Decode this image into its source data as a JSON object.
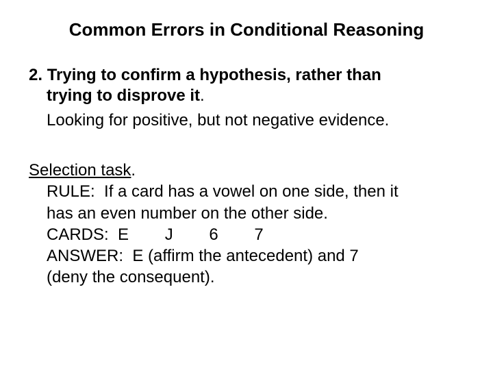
{
  "title": "Common Errors in Conditional Reasoning",
  "error": {
    "number": "2.",
    "heading_line1": "Trying to confirm a hypothesis, rather than",
    "heading_line2": "trying to disprove it",
    "heading_tail": ".",
    "explanation": "Looking for positive, but not negative evidence."
  },
  "task": {
    "label": "Selection task",
    "label_tail": ".",
    "rule_label": "RULE:",
    "rule_text_1": "If a card has a vowel on one side, then it",
    "rule_text_2": "has an even number on the other side.",
    "cards_label": "CARDS:",
    "cards": [
      "E",
      "J",
      "6",
      "7"
    ],
    "answer_label": "ANSWER:",
    "answer_text_1": "E (affirm the antecedent) and 7",
    "answer_text_2": "(deny the consequent)."
  }
}
